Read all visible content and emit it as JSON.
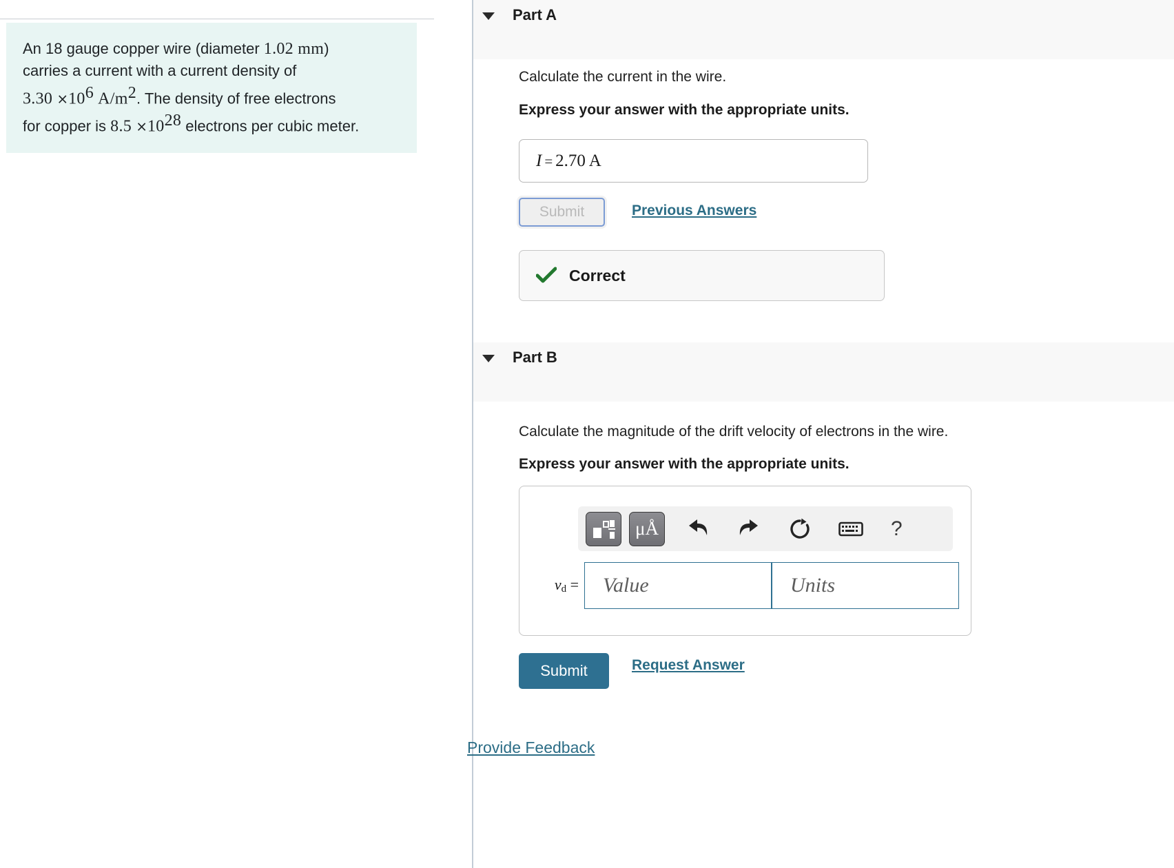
{
  "problem": {
    "line1_a": "An 18 gauge copper wire (diameter ",
    "line1_math": "1.02 mm",
    "line1_b": ")",
    "line2": "carries a current with a current density of",
    "density_value": "3.30",
    "density_times": "×",
    "density_base": "10",
    "density_exp": "6",
    "density_units": "A/m",
    "density_units_exp": "2",
    "line3_tail": ". The density of free electrons",
    "line4_head": "for copper is ",
    "n_value": "8.5",
    "n_times": "×",
    "n_base": "10",
    "n_exp": "28",
    "line4_tail": " electrons per cubic meter."
  },
  "part_a": {
    "label": "Part A",
    "prompt": "Calculate the current in the wire.",
    "instruction": "Express your answer with the appropriate units.",
    "answer_symbol": "I",
    "answer_equals": "=",
    "answer_value": "2.70 A",
    "submit_label": "Submit",
    "previous_answers_label": "Previous Answers",
    "feedback_status": "Correct",
    "check_icon": "check-icon",
    "submit_enabled": false
  },
  "part_b": {
    "label": "Part B",
    "prompt": "Calculate the magnitude of the drift velocity of electrons in the wire.",
    "instruction": "Express your answer with the appropriate units.",
    "variable_symbol": "v",
    "variable_subscript": "d",
    "variable_equals": "=",
    "value_placeholder": "Value",
    "units_placeholder": "Units",
    "submit_label": "Submit",
    "request_answer_label": "Request Answer",
    "toolbar": [
      {
        "name": "template-chooser-icon",
        "title": "templates"
      },
      {
        "name": "unit-symbols-icon",
        "title": "μÅ"
      },
      {
        "name": "undo-icon",
        "title": "undo"
      },
      {
        "name": "redo-icon",
        "title": "redo"
      },
      {
        "name": "reset-icon",
        "title": "reset"
      },
      {
        "name": "keyboard-icon",
        "title": "keyboard"
      },
      {
        "name": "help-icon",
        "title": "?"
      }
    ],
    "help_glyph": "?"
  },
  "footer": {
    "provide_feedback_label": "Provide Feedback"
  },
  "colors": {
    "accent": "#2e7091",
    "link": "#2c6d86",
    "problem_bg": "#e8f5f3",
    "header_bg": "#f8f8f8",
    "correct_check": "#23792f",
    "divider": "#c2ccd6"
  }
}
